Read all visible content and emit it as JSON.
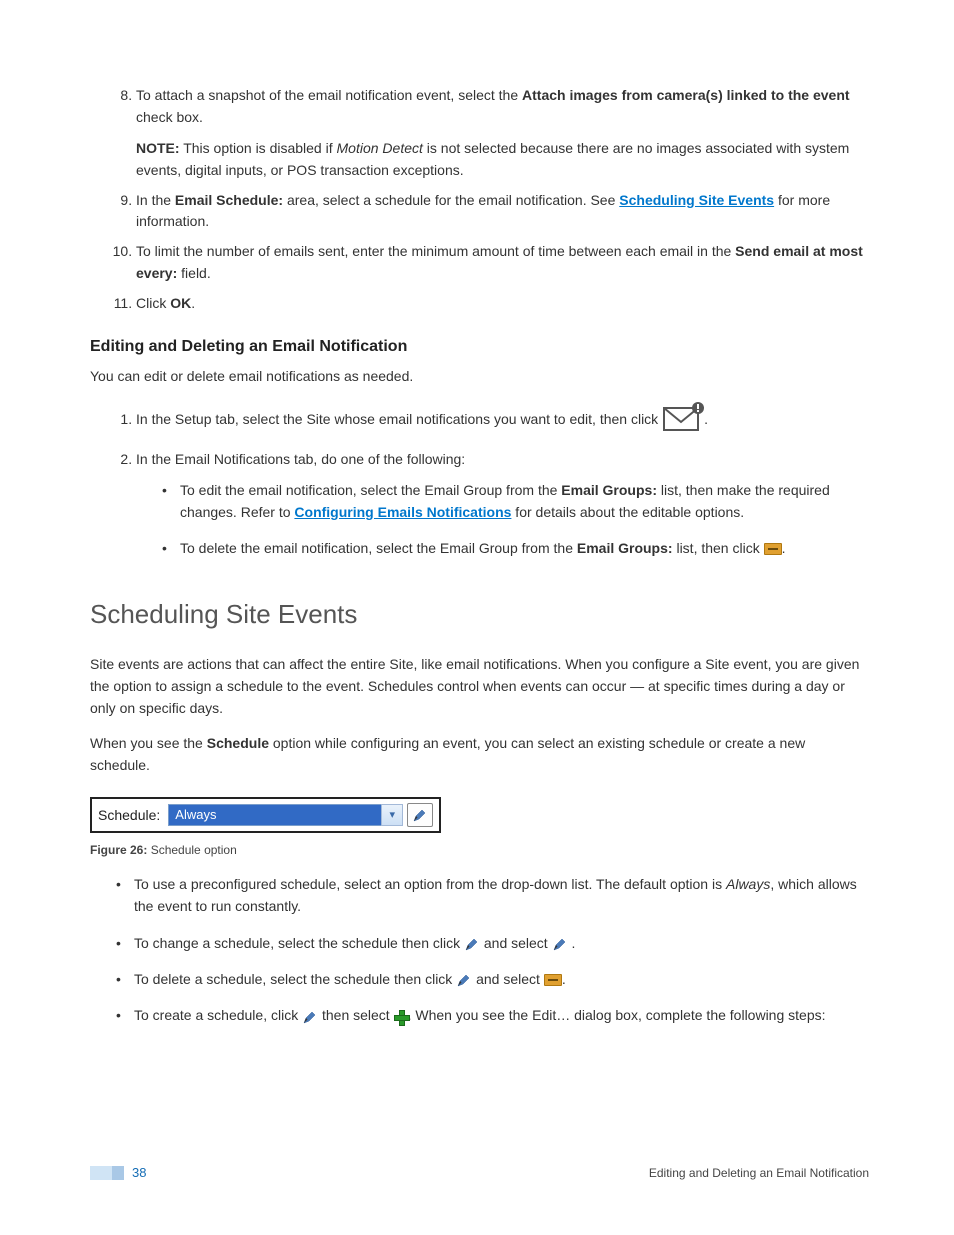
{
  "steps": {
    "s8_a": "To attach a snapshot of the email notification event, select the ",
    "s8_bold": "Attach images from camera(s) linked to the event",
    "s8_b": " check box.",
    "s8_note_label": "NOTE:",
    "s8_note_a": " This option is disabled if ",
    "s8_note_italic": "Motion Detect",
    "s8_note_b": " is not selected because there are no images associated with system events, digital inputs, or POS transaction exceptions.",
    "s9_a": "In the ",
    "s9_bold": "Email Schedule:",
    "s9_b": " area, select a schedule for the email notification. See ",
    "s9_link": "Scheduling Site Events",
    "s9_c": " for more information.",
    "s10_a": "To limit the number of emails sent, enter the minimum amount of time between each email in the ",
    "s10_bold": "Send email at most every:",
    "s10_b": " field.",
    "s11_a": "Click ",
    "s11_bold": "OK",
    "s11_b": "."
  },
  "edit_section": {
    "heading": "Editing and Deleting an Email Notification",
    "intro": "You can edit or delete email notifications as needed.",
    "item1_a": "In the Setup tab, select the Site whose email notifications you want to edit, then click ",
    "item1_b": ".",
    "item2": "In the Email Notifications tab, do one of the following:",
    "b1_a": "To edit the email notification, select the Email Group from the ",
    "b1_bold": "Email Groups:",
    "b1_b": " list, then make the required changes. Refer to ",
    "b1_link": "Configuring Emails Notifications",
    "b1_c": " for details about the editable options.",
    "b2_a": "To delete the email notification, select the Email Group from the ",
    "b2_bold": "Email Groups:",
    "b2_b": " list, then click ",
    "b2_c": "."
  },
  "sched_section": {
    "heading": "Scheduling Site Events",
    "p1": "Site events are actions that can affect the entire Site, like email notifications. When you configure a Site event, you are given the option to assign a schedule to the event. Schedules control when events can occur — at specific times during a day or only on specific days.",
    "p2_a": "When you see the ",
    "p2_bold": "Schedule",
    "p2_b": "  option while configuring an event, you can select an existing schedule or create a new schedule.",
    "dropdown_label": "Schedule:",
    "dropdown_value": "Always",
    "fig_label": "Figure 26:",
    "fig_text": " Schedule option",
    "b1_a": "To use a preconfigured schedule, select an option from the drop-down list. The default option is ",
    "b1_italic": "Always",
    "b1_b": ", which allows the event to run constantly.",
    "b2_a": "To change a schedule, select the schedule then click ",
    "b2_b": " and select ",
    "b2_c": " .",
    "b3_a": "To delete a schedule, select the schedule then click ",
    "b3_b": " and select ",
    "b3_c": ".",
    "b4_a": "To create a schedule, click ",
    "b4_b": " then select ",
    "b4_c": ". When you see the Edit… dialog box, complete the following steps:"
  },
  "footer": {
    "page_num": "38",
    "right": "Editing and Deleting an Email Notification"
  }
}
